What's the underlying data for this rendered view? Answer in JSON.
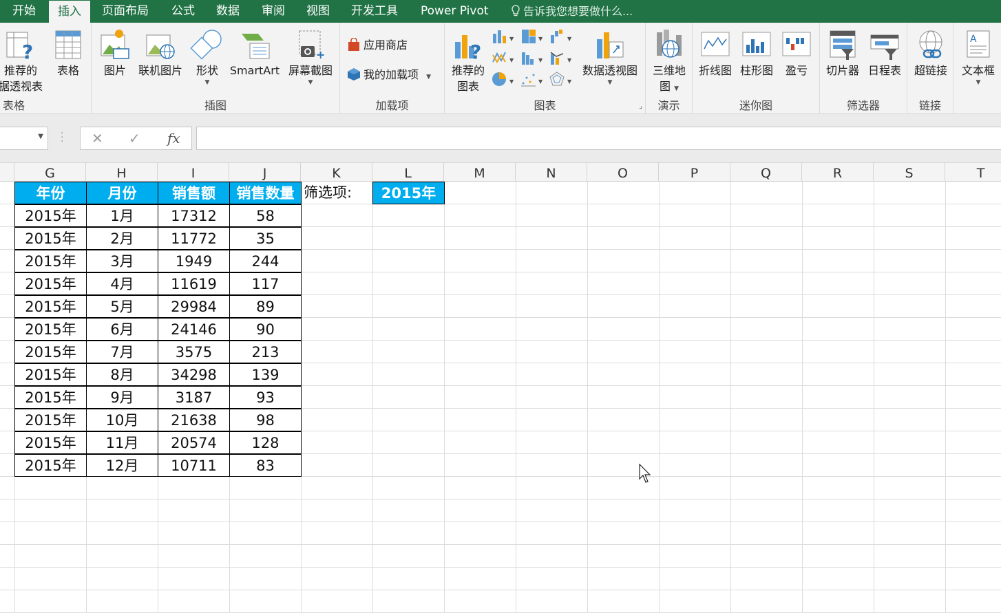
{
  "ribbon_tabs": [
    {
      "label": "开始",
      "active": false
    },
    {
      "label": "插入",
      "active": true
    },
    {
      "label": "页面布局",
      "active": false
    },
    {
      "label": "公式",
      "active": false
    },
    {
      "label": "数据",
      "active": false
    },
    {
      "label": "审阅",
      "active": false
    },
    {
      "label": "视图",
      "active": false
    },
    {
      "label": "开发工具",
      "active": false
    },
    {
      "label": "Power Pivot",
      "active": false
    }
  ],
  "tell_me": "告诉我您想要做什么...",
  "ribbon": {
    "tables": {
      "label": "表格",
      "recommended_pivot": [
        "推荐的",
        "据透视表"
      ],
      "table": "表格"
    },
    "illustrations": {
      "label": "插图",
      "picture": "图片",
      "online_picture": "联机图片",
      "shapes": "形状",
      "smartart": "SmartArt",
      "screenshot": "屏幕截图"
    },
    "addins": {
      "label": "加载项",
      "store": "应用商店",
      "my_addins": "我的加载项"
    },
    "charts": {
      "label": "图表",
      "recommended_charts": [
        "推荐的",
        "图表"
      ],
      "pivot_chart": "数据透视图"
    },
    "tours": {
      "label": "演示",
      "map3d": [
        "三维地",
        "图"
      ]
    },
    "sparklines": {
      "label": "迷你图",
      "line": "折线图",
      "column": "柱形图",
      "winloss": "盈亏"
    },
    "filters": {
      "label": "筛选器",
      "slicer": "切片器",
      "timeline": "日程表"
    },
    "links": {
      "label": "链接",
      "hyperlink": "超链接"
    },
    "text": {
      "textbox": "文本框"
    }
  },
  "formula_bar": {
    "name_box": "",
    "formula": "",
    "fx": "fx"
  },
  "columns": [
    "G",
    "H",
    "I",
    "J",
    "K",
    "L",
    "M",
    "N",
    "O",
    "P",
    "Q",
    "R",
    "S",
    "T"
  ],
  "table": {
    "headers": [
      "年份",
      "月份",
      "销售额",
      "销售数量"
    ],
    "rows": [
      [
        "2015年",
        "1月",
        "17312",
        "58"
      ],
      [
        "2015年",
        "2月",
        "11772",
        "35"
      ],
      [
        "2015年",
        "3月",
        "1949",
        "244"
      ],
      [
        "2015年",
        "4月",
        "11619",
        "117"
      ],
      [
        "2015年",
        "5月",
        "29984",
        "89"
      ],
      [
        "2015年",
        "6月",
        "24146",
        "90"
      ],
      [
        "2015年",
        "7月",
        "3575",
        "213"
      ],
      [
        "2015年",
        "8月",
        "34298",
        "139"
      ],
      [
        "2015年",
        "9月",
        "3187",
        "93"
      ],
      [
        "2015年",
        "10月",
        "21638",
        "98"
      ],
      [
        "2015年",
        "11月",
        "20574",
        "128"
      ],
      [
        "2015年",
        "12月",
        "10711",
        "83"
      ]
    ]
  },
  "filter": {
    "label": "筛选项:",
    "value": "2015年"
  },
  "colors": {
    "ribbon_green": "#217346",
    "header_blue": "#00aeef"
  }
}
